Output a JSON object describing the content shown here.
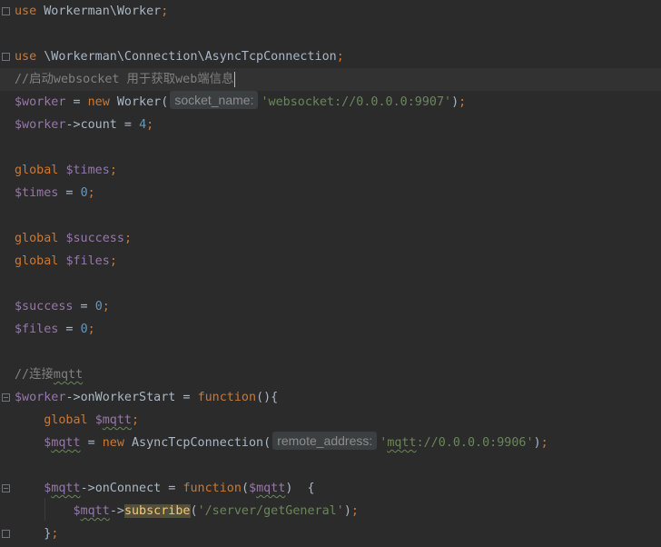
{
  "editor": {
    "lines": {
      "l1": {
        "kw": "use",
        "rest": " Workerman\\Worker",
        "semi": ";"
      },
      "l3": {
        "kw": "use",
        "rest": " \\Workerman\\Connection\\AsyncTcpConnection",
        "semi": ";"
      },
      "l4": {
        "comment": "//启动websocket 用于获取web端信息"
      },
      "l5": {
        "var": "$worker",
        "eq": " = ",
        "kw": "new",
        "cls": " Worker(",
        "hint": "socket_name:",
        "str": "'websocket://0.0.0.0:9907'",
        "close": ")",
        "semi": ";"
      },
      "l6": {
        "var": "$worker",
        "arrow": "->",
        "prop": "count",
        "eq": " = ",
        "num": "4",
        "semi": ";"
      },
      "l8": {
        "kw": "global",
        "sp": " ",
        "var": "$times",
        "semi": ";"
      },
      "l9": {
        "var": "$times",
        "eq": " = ",
        "num": "0",
        "semi": ";"
      },
      "l11": {
        "kw": "global",
        "sp": " ",
        "var": "$success",
        "semi": ";"
      },
      "l12": {
        "kw": "global",
        "sp": " ",
        "var": "$files",
        "semi": ";"
      },
      "l14": {
        "var": "$success",
        "eq": " = ",
        "num": "0",
        "semi": ";"
      },
      "l15": {
        "var": "$files",
        "eq": " = ",
        "num": "0",
        "semi": ";"
      },
      "l17": {
        "comment_pre": "//连接",
        "comment_typo": "mqtt"
      },
      "l18": {
        "var": "$worker",
        "arrow": "->",
        "prop": "onWorkerStart",
        "eq": " = ",
        "kw": "function",
        "rest": "(){"
      },
      "l19": {
        "indent": "    ",
        "kw": "global",
        "sp": " ",
        "var_pre": "$",
        "var_typo": "mqtt",
        "semi": ";"
      },
      "l20": {
        "indent": "    ",
        "var_pre": "$",
        "var_typo": "mqtt",
        "eq": " = ",
        "kw": "new",
        "cls": " AsyncTcpConnection(",
        "hint": "remote_address:",
        "str_pre": "'",
        "str_typo": "mqtt",
        "str_rest": "://0.0.0.0:9906'",
        "close": ")",
        "semi": ";"
      },
      "l22": {
        "indent": "    ",
        "var_pre": "$",
        "var_typo": "mqtt",
        "arrow": "->",
        "prop": "onConnect",
        "eq": " = ",
        "kw": "function",
        "open": "(",
        "param_pre": "$",
        "param_typo": "mqtt",
        "rest": ")  {"
      },
      "l23": {
        "indent": "        ",
        "var_pre": "$",
        "var_typo": "mqtt",
        "arrow": "->",
        "call": "subscribe",
        "open": "(",
        "str": "'/server/getGeneral'",
        "close": ")",
        "semi": ";"
      },
      "l24": {
        "indent": "    ",
        "rest": "}",
        "semi": ";"
      }
    }
  }
}
